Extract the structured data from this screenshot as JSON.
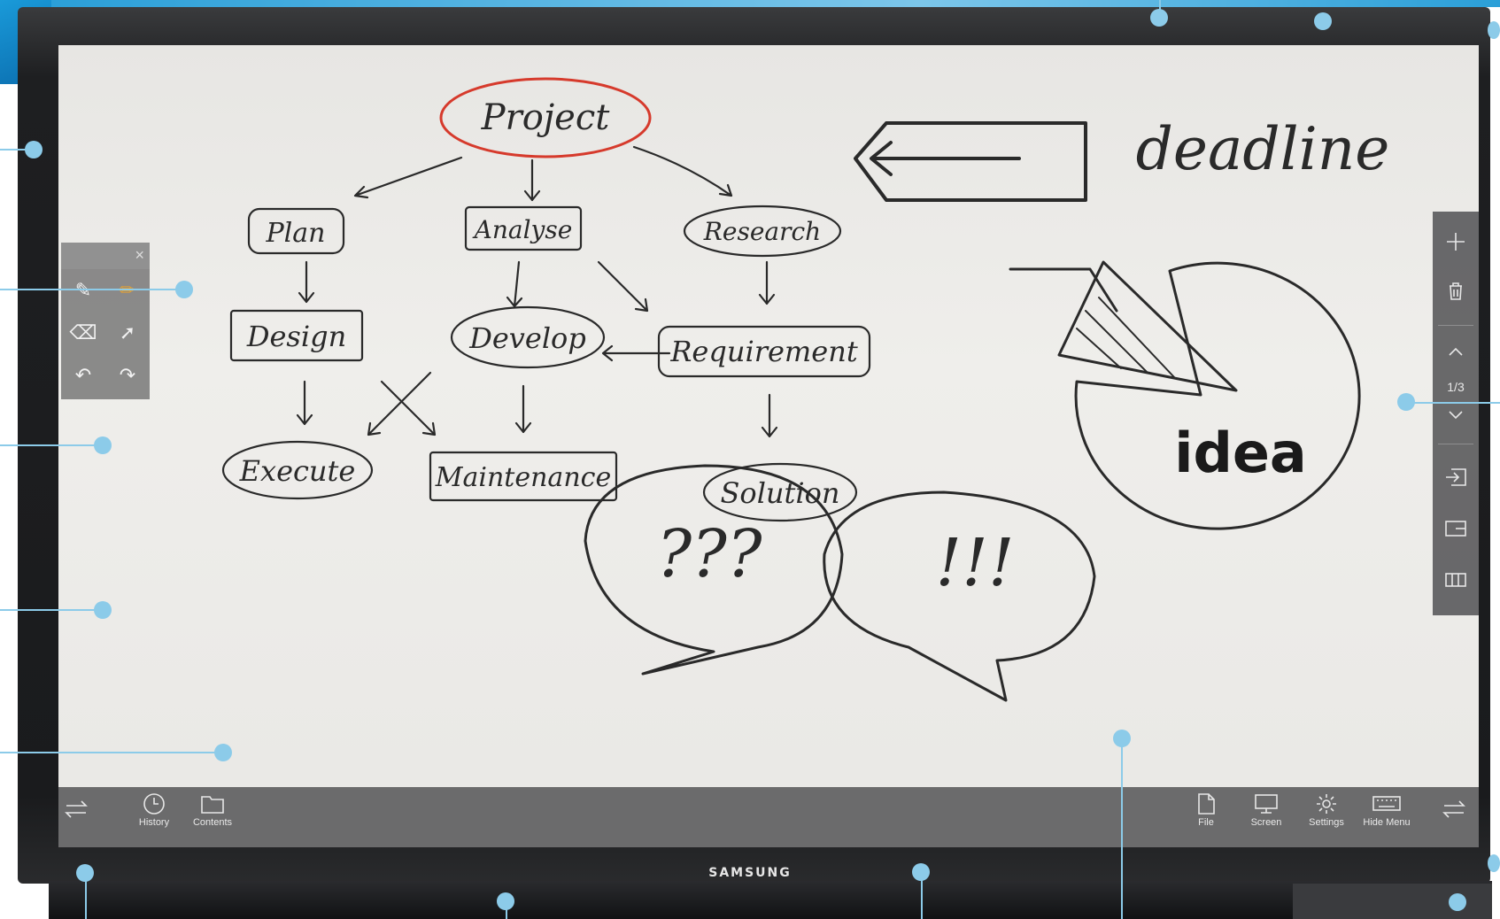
{
  "device": {
    "brand": "SAMSUNG"
  },
  "left_toolbar": {
    "close_label": "×",
    "tools": [
      "pen-icon",
      "pencil-icon",
      "eraser-icon",
      "select-arrow-icon",
      "undo-icon",
      "redo-icon"
    ]
  },
  "right_toolbar": {
    "page_indicator": "1/3",
    "buttons": [
      "add-page-icon",
      "delete-page-icon",
      "page-up-icon",
      "page-down-icon",
      "import-icon",
      "layout-icon",
      "split-view-icon"
    ]
  },
  "bottom_bar": {
    "left": [
      {
        "label": "History",
        "icon": "clock-icon"
      },
      {
        "label": "Contents",
        "icon": "folder-icon"
      }
    ],
    "right": [
      {
        "label": "File",
        "icon": "file-icon"
      },
      {
        "label": "Screen",
        "icon": "monitor-icon"
      },
      {
        "label": "Settings",
        "icon": "gear-icon"
      },
      {
        "label": "Hide Menu",
        "icon": "keyboard-icon"
      }
    ],
    "swap_icons": [
      "swap-arrows-icon",
      "swap-arrows-icon"
    ]
  },
  "whiteboard": {
    "nodes": [
      {
        "text": "Project",
        "shape": "ellipse",
        "color": "#d63a2c"
      },
      {
        "text": "Plan",
        "shape": "rounded"
      },
      {
        "text": "Analyse",
        "shape": "rect"
      },
      {
        "text": "Research",
        "shape": "ellipse"
      },
      {
        "text": "Design",
        "shape": "rect"
      },
      {
        "text": "Develop",
        "shape": "ellipse"
      },
      {
        "text": "Requirement",
        "shape": "rounded"
      },
      {
        "text": "Execute",
        "shape": "ellipse"
      },
      {
        "text": "Maintenance",
        "shape": "rect"
      },
      {
        "text": "Solution",
        "shape": "ellipse"
      }
    ],
    "sketch_texts": {
      "deadline": "deadline",
      "idea": "idea",
      "question": "???",
      "exclaim": "!!!"
    }
  },
  "colors": {
    "accent_blue": "#8ccbe9",
    "project_red": "#d63a2c",
    "ink": "#2a2a2a"
  }
}
